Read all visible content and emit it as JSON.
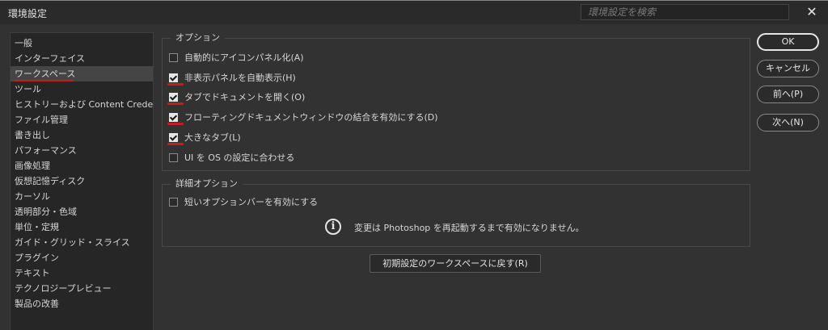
{
  "window": {
    "title": "環境設定",
    "close_glyph": "✕"
  },
  "search": {
    "placeholder": "環境設定を検索"
  },
  "sidebar": {
    "items": [
      "一般",
      "インターフェイス",
      "ワークスペース",
      "ツール",
      "ヒストリーおよび Content Credentials",
      "ファイル管理",
      "書き出し",
      "パフォーマンス",
      "画像処理",
      "仮想記憶ディスク",
      "カーソル",
      "透明部分・色域",
      "単位・定規",
      "ガイド・グリッド・スライス",
      "プラグイン",
      "テキスト",
      "テクノロジープレビュー",
      "製品の改善"
    ],
    "selected_index": 2
  },
  "options": {
    "title": "オプション",
    "items": [
      {
        "label": "自動的にアイコンパネル化(A)",
        "checked": false
      },
      {
        "label": "非表示パネルを自動表示(H)",
        "checked": true
      },
      {
        "label": "タブでドキュメントを開く(O)",
        "checked": true
      },
      {
        "label": "フローティングドキュメントウィンドウの結合を有効にする(D)",
        "checked": true
      },
      {
        "label": "大きなタブ(L)",
        "checked": true
      },
      {
        "label": "UI を OS の設定に合わせる",
        "checked": false
      }
    ]
  },
  "advanced": {
    "title": "詳細オプション",
    "items": [
      {
        "label": "短いオプションバーを有効にする",
        "checked": false
      }
    ],
    "info_icon_glyph": "i",
    "info_text": "変更は Photoshop を再起動するまで有効になりません。"
  },
  "reset_button": {
    "label": "初期設定のワークスペースに戻す(R)"
  },
  "buttons": {
    "ok": "OK",
    "cancel": "キャンセル",
    "prev": "前へ(P)",
    "next": "次へ(N)"
  },
  "colors": {
    "background": "#323232",
    "panel": "#262626",
    "annotation_red": "#cc1a1a"
  }
}
